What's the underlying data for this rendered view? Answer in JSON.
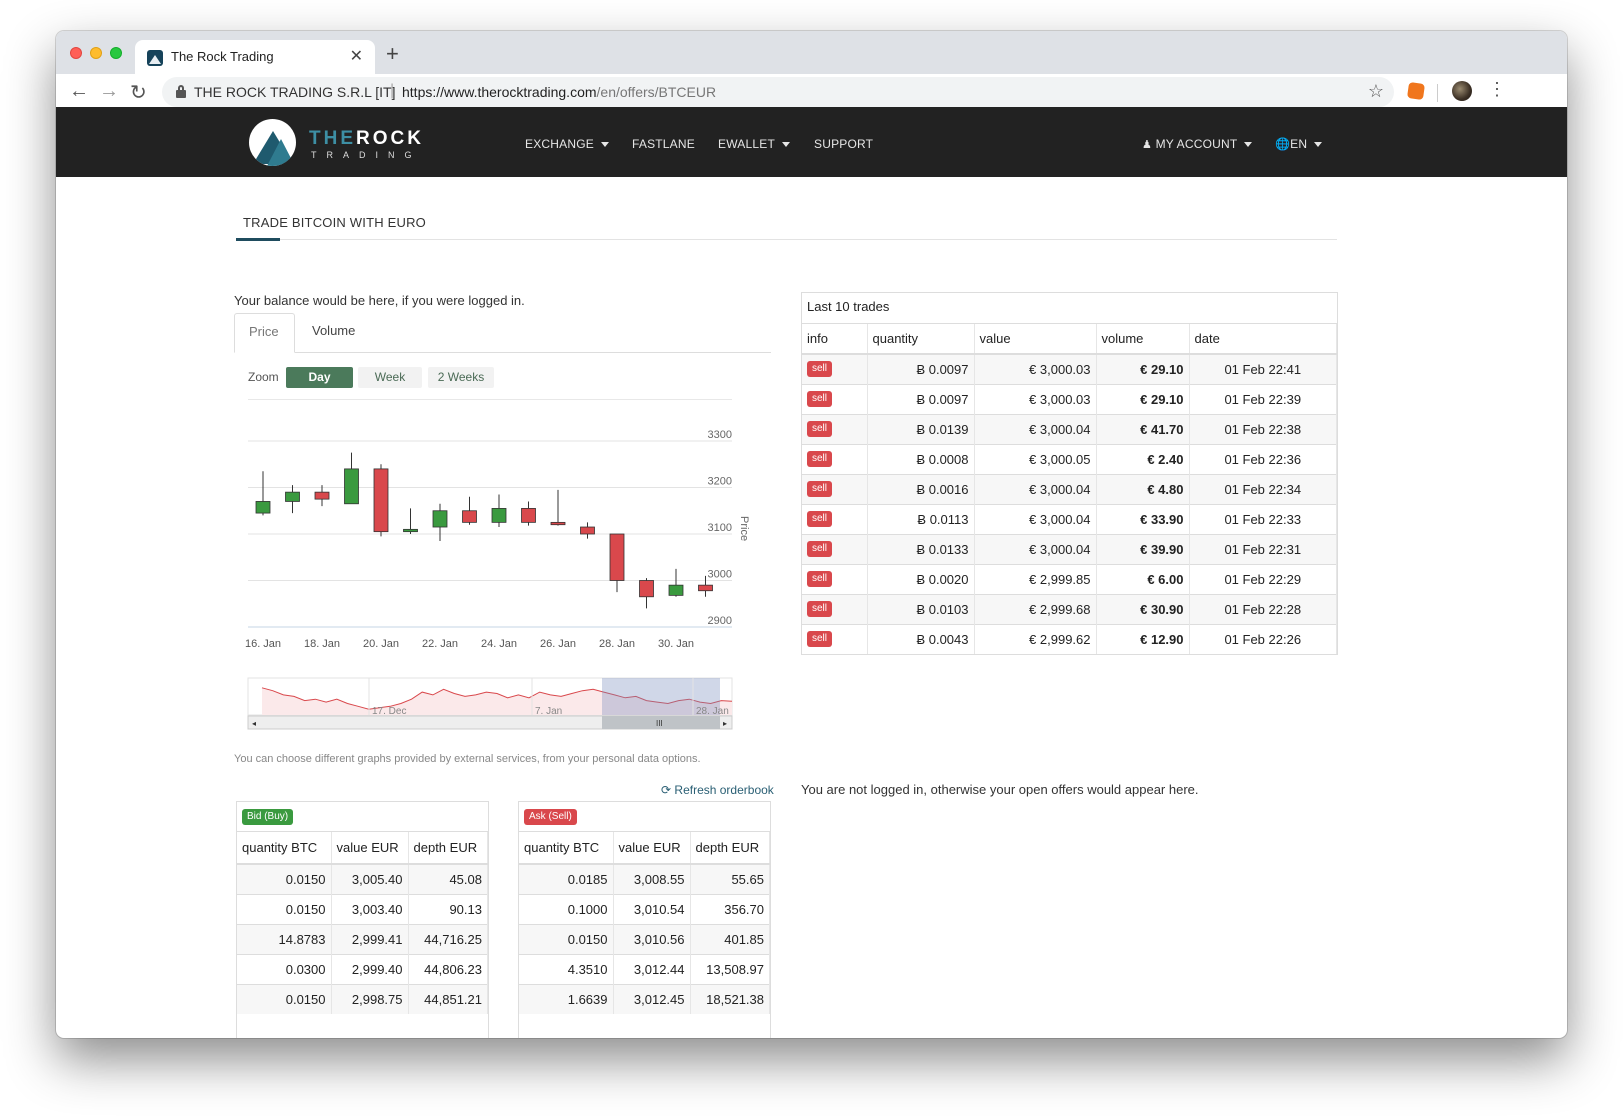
{
  "browser": {
    "tab_title": "The Rock Trading",
    "tab_close": "✕",
    "new_tab": "+",
    "cert_owner": "THE ROCK TRADING S.R.L [IT]",
    "url_host": "https://www.therocktrading.com",
    "url_path": "/en/offers/BTCEUR",
    "back": "←",
    "forward": "→",
    "reload": "↻",
    "star": "☆",
    "menu": "⋮"
  },
  "site": {
    "logo_the": "THE",
    "logo_rock": "ROCK",
    "logo_sub": "TRADING",
    "nav": [
      {
        "label": "EXCHANGE",
        "caret": true
      },
      {
        "label": "FASTLANE",
        "caret": false
      },
      {
        "label": "EWALLET",
        "caret": true
      },
      {
        "label": "SUPPORT",
        "caret": false
      }
    ],
    "account": "MY ACCOUNT",
    "language": "EN"
  },
  "page": {
    "tab": "TRADE BITCOIN WITH EURO",
    "balance_note": "Your balance would be here, if you were logged in.",
    "chart_tabs": [
      "Price",
      "Volume"
    ],
    "zoom_label": "Zoom",
    "zoom_buttons": [
      "Day",
      "Week",
      "2 Weeks"
    ],
    "zoom_selected": "Day",
    "orders_hint": "You can choose different graphs provided by external services, from your personal data options.",
    "refresh": "Refresh orderbook",
    "not_logged": "You are not logged in, otherwise your open offers would appear here."
  },
  "chart_data": {
    "type": "candlestick",
    "ylabel": "Price",
    "ylim": [
      2900,
      3300
    ],
    "yticks": [
      2900,
      3000,
      3100,
      3200,
      3300
    ],
    "x_tick_labels": [
      "16. Jan",
      "18. Jan",
      "20. Jan",
      "22. Jan",
      "24. Jan",
      "26. Jan",
      "28. Jan",
      "30. Jan"
    ],
    "up_color": "#3a9a3f",
    "down_color": "#d9484c",
    "candles": [
      {
        "day": "16. Jan",
        "open": 3145,
        "close": 3170,
        "high": 3235,
        "low": 3140
      },
      {
        "day": "17. Jan",
        "open": 3170,
        "close": 3190,
        "high": 3205,
        "low": 3145
      },
      {
        "day": "18. Jan",
        "open": 3190,
        "close": 3175,
        "high": 3205,
        "low": 3160
      },
      {
        "day": "19. Jan",
        "open": 3165,
        "close": 3240,
        "high": 3275,
        "low": 3165
      },
      {
        "day": "20. Jan",
        "open": 3240,
        "close": 3105,
        "high": 3250,
        "low": 3095
      },
      {
        "day": "21. Jan",
        "open": 3105,
        "close": 3110,
        "high": 3155,
        "low": 3100
      },
      {
        "day": "22. Jan",
        "open": 3115,
        "close": 3150,
        "high": 3165,
        "low": 3085
      },
      {
        "day": "23. Jan",
        "open": 3150,
        "close": 3125,
        "high": 3180,
        "low": 3120
      },
      {
        "day": "24. Jan",
        "open": 3125,
        "close": 3155,
        "high": 3185,
        "low": 3115
      },
      {
        "day": "25. Jan",
        "open": 3155,
        "close": 3125,
        "high": 3170,
        "low": 3118
      },
      {
        "day": "26. Jan",
        "open": 3125,
        "close": 3120,
        "high": 3195,
        "low": 3118
      },
      {
        "day": "27. Jan",
        "open": 3115,
        "close": 3100,
        "high": 3125,
        "low": 3090
      },
      {
        "day": "28. Jan",
        "open": 3100,
        "close": 3000,
        "high": 3100,
        "low": 2975
      },
      {
        "day": "29. Jan",
        "open": 3000,
        "close": 2965,
        "high": 3005,
        "low": 2940
      },
      {
        "day": "30. Jan",
        "open": 2968,
        "close": 2990,
        "high": 3025,
        "low": 2965
      },
      {
        "day": "31. Jan",
        "open": 2990,
        "close": 2978,
        "high": 3010,
        "low": 2965
      }
    ],
    "navigator_labels": [
      "17. Dec",
      "7. Jan",
      "28. Jan"
    ],
    "navigator_series": [
      3215,
      3205,
      3190,
      3185,
      3170,
      3175,
      3165,
      3175,
      3160,
      3150,
      3140,
      3145,
      3150,
      3160,
      3175,
      3200,
      3190,
      3210,
      3195,
      3185,
      3190,
      3200,
      3195,
      3180,
      3190,
      3180,
      3200,
      3190,
      3185,
      3195,
      3205,
      3210,
      3200,
      3190,
      3180,
      3185,
      3170,
      3165,
      3160,
      3170,
      3175,
      3165,
      3160,
      3170,
      3168
    ],
    "navigator_window": [
      "28. Jan"
    ]
  },
  "bids": {
    "badge": "Bid (Buy)",
    "headers": [
      "quantity BTC",
      "value EUR",
      "depth EUR"
    ],
    "rows": [
      [
        "0.0150",
        "3,005.40",
        "45.08"
      ],
      [
        "0.0150",
        "3,003.40",
        "90.13"
      ],
      [
        "14.8783",
        "2,999.41",
        "44,716.25"
      ],
      [
        "0.0300",
        "2,999.40",
        "44,806.23"
      ],
      [
        "0.0150",
        "2,998.75",
        "44,851.21"
      ]
    ]
  },
  "asks": {
    "badge": "Ask (Sell)",
    "headers": [
      "quantity BTC",
      "value EUR",
      "depth EUR"
    ],
    "rows": [
      [
        "0.0185",
        "3,008.55",
        "55.65"
      ],
      [
        "0.1000",
        "3,010.54",
        "356.70"
      ],
      [
        "0.0150",
        "3,010.56",
        "401.85"
      ],
      [
        "4.3510",
        "3,012.44",
        "13,508.97"
      ],
      [
        "1.6639",
        "3,012.45",
        "18,521.38"
      ]
    ]
  },
  "trades": {
    "caption": "Last 10 trades",
    "headers": [
      "info",
      "quantity",
      "value",
      "volume",
      "date"
    ],
    "rows": [
      [
        "sell",
        "Ƀ 0.0097",
        "€ 3,000.03",
        "€ 29.10",
        "01 Feb 22:41"
      ],
      [
        "sell",
        "Ƀ 0.0097",
        "€ 3,000.03",
        "€ 29.10",
        "01 Feb 22:39"
      ],
      [
        "sell",
        "Ƀ 0.0139",
        "€ 3,000.04",
        "€ 41.70",
        "01 Feb 22:38"
      ],
      [
        "sell",
        "Ƀ 0.0008",
        "€ 3,000.05",
        "€ 2.40",
        "01 Feb 22:36"
      ],
      [
        "sell",
        "Ƀ 0.0016",
        "€ 3,000.04",
        "€ 4.80",
        "01 Feb 22:34"
      ],
      [
        "sell",
        "Ƀ 0.0113",
        "€ 3,000.04",
        "€ 33.90",
        "01 Feb 22:33"
      ],
      [
        "sell",
        "Ƀ 0.0133",
        "€ 3,000.04",
        "€ 39.90",
        "01 Feb 22:31"
      ],
      [
        "sell",
        "Ƀ 0.0020",
        "€ 2,999.85",
        "€ 6.00",
        "01 Feb 22:29"
      ],
      [
        "sell",
        "Ƀ 0.0103",
        "€ 2,999.68",
        "€ 30.90",
        "01 Feb 22:28"
      ],
      [
        "sell",
        "Ƀ 0.0043",
        "€ 2,999.62",
        "€ 12.90",
        "01 Feb 22:26"
      ]
    ]
  }
}
